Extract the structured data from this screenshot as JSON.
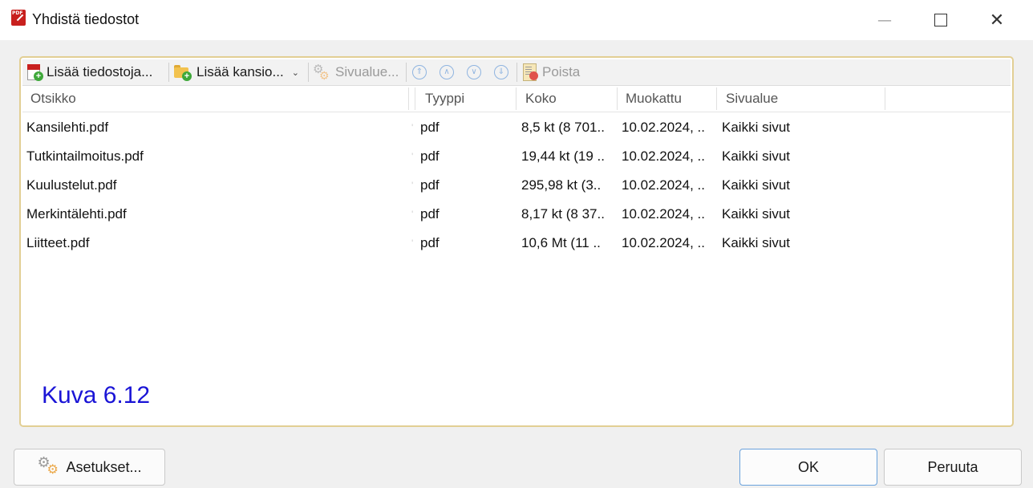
{
  "window": {
    "title": "Yhdistä tiedostot",
    "app_icon": "foxit-pdf-icon",
    "controls": [
      "minimize-icon",
      "maximize-icon",
      "close-icon"
    ],
    "close_glyph": "✕"
  },
  "toolbar": {
    "add_files": "Lisää tiedostoja...",
    "add_folder": "Lisää kansio...",
    "page_range": "Sivualue...",
    "delete": "Poista",
    "nav_icons": [
      "move-to-top-icon",
      "move-up-icon",
      "move-down-icon",
      "move-to-bottom-icon"
    ]
  },
  "table": {
    "columns": [
      "Otsikko",
      "Tyyppi",
      "Koko",
      "Muokattu",
      "Sivualue"
    ],
    "rows": [
      {
        "name": "Kansilehti.pdf",
        "type": "pdf",
        "size": "8,5 kt (8 701..",
        "modified": "10.02.2024, ..",
        "range": "Kaikki sivut"
      },
      {
        "name": "Tutkintailmoitus.pdf",
        "type": "pdf",
        "size": "19,44 kt (19 ..",
        "modified": "10.02.2024, ..",
        "range": "Kaikki sivut"
      },
      {
        "name": "Kuulustelut.pdf",
        "type": "pdf",
        "size": "295,98 kt (3..",
        "modified": "10.02.2024, ..",
        "range": "Kaikki sivut"
      },
      {
        "name": "Merkintälehti.pdf",
        "type": "pdf",
        "size": "8,17 kt (8 37..",
        "modified": "10.02.2024, ..",
        "range": "Kaikki sivut"
      },
      {
        "name": "Liitteet.pdf",
        "type": "pdf",
        "size": "10,6 Mt (11 ..",
        "modified": "10.02.2024, ..",
        "range": "Kaikki sivut"
      }
    ]
  },
  "caption": "Kuva 6.12",
  "buttons": {
    "settings": "Asetukset...",
    "ok": "OK",
    "cancel": "Peruuta"
  },
  "colors": {
    "frame_border": "#e2cf94",
    "caption": "#1a14d6",
    "ok_border": "#6aa2dc"
  }
}
